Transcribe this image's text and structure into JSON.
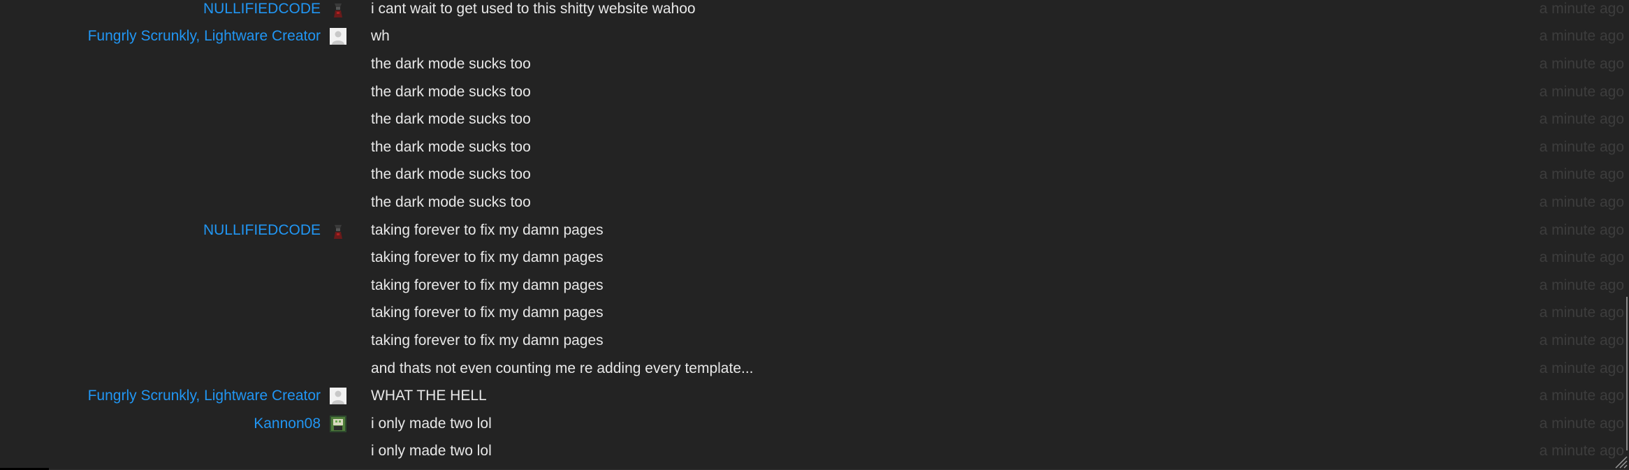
{
  "messages": [
    {
      "author": "NULLIFIEDCODE",
      "avatar": "nullified-avatar",
      "text": "i cant wait to get used to this shitty website wahoo",
      "time": "a minute ago"
    },
    {
      "author": "Fungrly Scrunkly, Lightware Creator",
      "avatar": "default-user-avatar",
      "text": "wh",
      "time": "a minute ago"
    },
    {
      "author": "",
      "avatar": "",
      "text": "the dark mode sucks too",
      "time": "a minute ago"
    },
    {
      "author": "",
      "avatar": "",
      "text": "the dark mode sucks too",
      "time": "a minute ago"
    },
    {
      "author": "",
      "avatar": "",
      "text": "the dark mode sucks too",
      "time": "a minute ago"
    },
    {
      "author": "",
      "avatar": "",
      "text": "the dark mode sucks too",
      "time": "a minute ago"
    },
    {
      "author": "",
      "avatar": "",
      "text": "the dark mode sucks too",
      "time": "a minute ago"
    },
    {
      "author": "",
      "avatar": "",
      "text": "the dark mode sucks too",
      "time": "a minute ago"
    },
    {
      "author": "NULLIFIEDCODE",
      "avatar": "nullified-avatar",
      "text": "taking forever to fix my damn pages",
      "time": "a minute ago"
    },
    {
      "author": "",
      "avatar": "",
      "text": "taking forever to fix my damn pages",
      "time": "a minute ago"
    },
    {
      "author": "",
      "avatar": "",
      "text": "taking forever to fix my damn pages",
      "time": "a minute ago"
    },
    {
      "author": "",
      "avatar": "",
      "text": "taking forever to fix my damn pages",
      "time": "a minute ago"
    },
    {
      "author": "",
      "avatar": "",
      "text": "taking forever to fix my damn pages",
      "time": "a minute ago"
    },
    {
      "author": "",
      "avatar": "",
      "text": "and thats not even counting me re adding every template...",
      "time": "a minute ago"
    },
    {
      "author": "Fungrly Scrunkly, Lightware Creator",
      "avatar": "default-user-avatar",
      "text": "WHAT THE HELL",
      "time": "a minute ago"
    },
    {
      "author": "Kannon08",
      "avatar": "kannon-avatar",
      "text": "i only made two lol",
      "time": "a minute ago"
    },
    {
      "author": "",
      "avatar": "",
      "text": "i only made two lol",
      "time": "a minute ago"
    }
  ],
  "colors": {
    "background": "#232323",
    "author": "#2196f3",
    "message": "#e8e8e8",
    "timestamp": "#3d3d3d"
  }
}
